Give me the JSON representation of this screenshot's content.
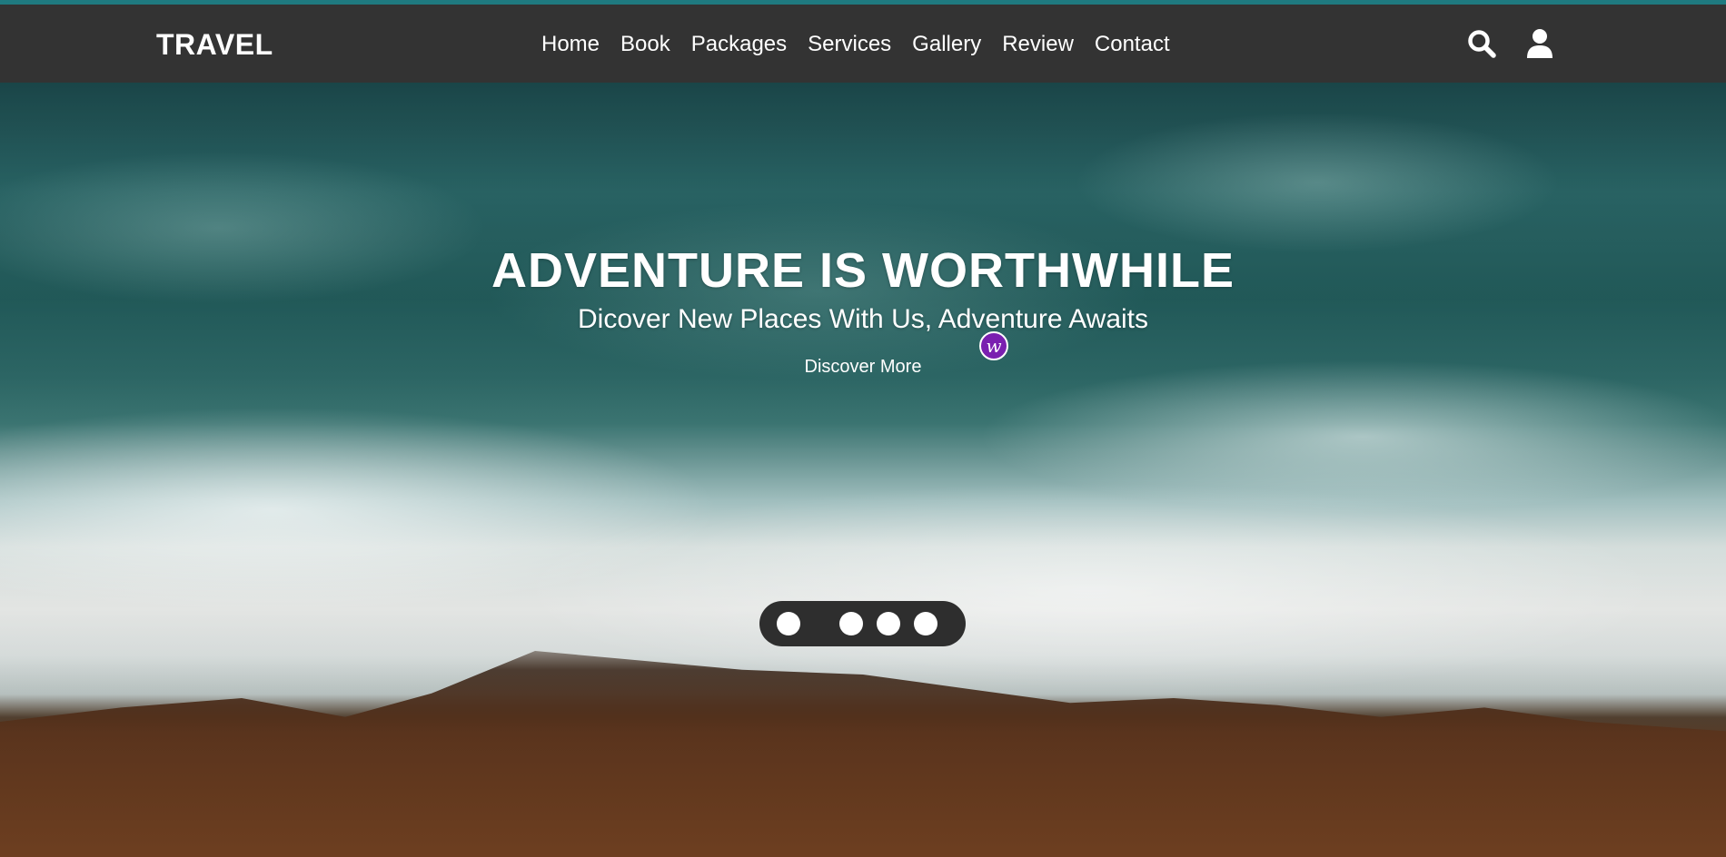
{
  "header": {
    "logo": "TRAVEL",
    "nav": [
      "Home",
      "Book",
      "Packages",
      "Services",
      "Gallery",
      "Review",
      "Contact"
    ],
    "icons": [
      "search-icon",
      "user-icon"
    ]
  },
  "hero": {
    "title": "ADVENTURE IS WORTHWHILE",
    "subtitle": "Dicover New Places With Us, Adventure Awaits",
    "cta": "Discover More",
    "slides": 4,
    "active_slide": 1
  },
  "colors": {
    "top_accent": "#1f7a80",
    "header_bg": "#333333",
    "badge": "#7a1fb0",
    "slider_bg": "#2e2e2e"
  }
}
